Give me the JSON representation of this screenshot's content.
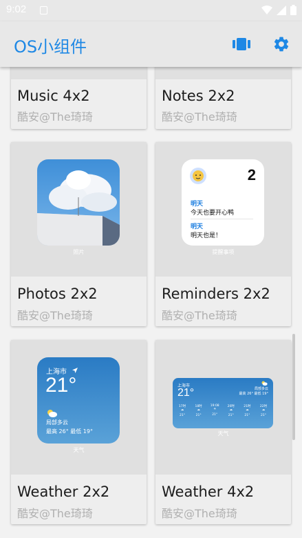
{
  "status": {
    "time": "9:02"
  },
  "appbar": {
    "title": "OS小组件"
  },
  "cards": [
    {
      "name": "Music 4x2",
      "author": "酷安@The琦琦"
    },
    {
      "name": "Notes 2x2",
      "author": "酷安@The琦琦"
    },
    {
      "name": "Photos 2x2",
      "author": "酷安@The琦琦",
      "caption": "照片"
    },
    {
      "name": "Reminders 2x2",
      "author": "酷安@The琦琦",
      "caption": "提醒事项"
    },
    {
      "name": "Weather 2x2",
      "author": "酷安@The琦琦",
      "caption": "天气"
    },
    {
      "name": "Weather 4x2",
      "author": "酷安@The琦琦",
      "caption": "天气"
    }
  ],
  "reminders_widget": {
    "count": "2",
    "items": [
      {
        "label": "明天",
        "text": "今天也要开心鸭"
      },
      {
        "label": "明天",
        "text": "明天也是！"
      }
    ]
  },
  "weather2": {
    "city": "上海市",
    "temp": "21°",
    "condition": "局部多云",
    "range": "最高 26° 最低 19°"
  },
  "weather4": {
    "city": "上海市",
    "temp": "21°",
    "condition": "局部多云",
    "range": "最高 26° 最低 19°",
    "hours": [
      {
        "time": "17时",
        "temp": "21°"
      },
      {
        "time": "18时",
        "temp": "21°"
      },
      {
        "time": "19:08",
        "temp": "21°"
      },
      {
        "time": "20时",
        "temp": "21°"
      },
      {
        "time": "21时",
        "temp": "21°"
      },
      {
        "time": "22时",
        "temp": "21°"
      }
    ]
  },
  "colors": {
    "accent": "#1e88e5",
    "appbar": "#e8e8e8",
    "card": "#eeeeee"
  }
}
